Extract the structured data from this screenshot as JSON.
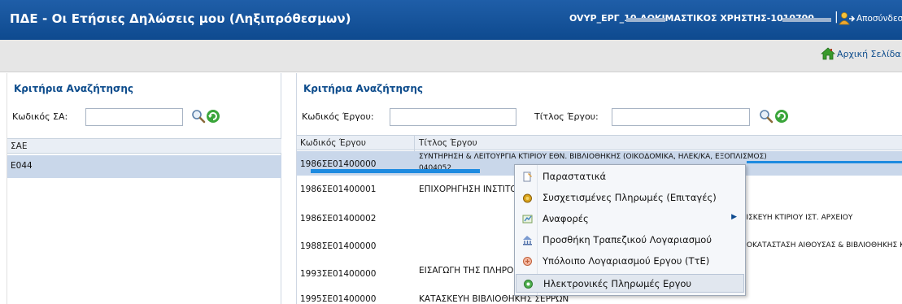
{
  "header": {
    "title": "ΠΔΕ - Οι Ετήσιες Δηλώσεις μου (Ληξιπρόθεσμων)",
    "user": "OVYP_ΕΡΓ_10-ΔΟΚΙΜΑΣΤΙΚΟΣ ΧΡΗΣΤΗΣ-1010700",
    "separator": "|",
    "logout_label": "Αποσύνδεση"
  },
  "subbar": {
    "home_label": "Αρχική Σελίδα"
  },
  "left_panel": {
    "title": "Κριτήρια Αναζήτησης",
    "code_label": "Κωδικός ΣΑ:",
    "code_value": "",
    "grid_header": "ΣΑΕ",
    "rows": [
      "E044"
    ]
  },
  "right_panel": {
    "title": "Κριτήρια Αναζήτησης",
    "project_code_label": "Κωδικός Έργου:",
    "project_code_value": "",
    "project_title_label": "Τίτλος Έργου:",
    "project_title_value": "",
    "columns": [
      "Κωδικός Έργου",
      "Τίτλος Έργου"
    ],
    "rows": [
      {
        "code": "1986ΣΕ01400000",
        "title": "ΣΥΝΤΗΡΗΣΗ & ΛΕΙΤΟΥΡΓΙΑ ΚΤΙΡΙΟΥ ΕΘΝ. ΒΙΒΛΙΟΘΗΚΗΣ (ΟΙΚΟΔΟΜΙΚΑ, ΗΛΕΚ/ΚΑ, ΕΞΟΠΛΙΣΜΟΣ)",
        "title2": "0404052"
      },
      {
        "code": "1986ΣΕ01400001",
        "title": "ΕΠΙΧΟΡΗΓΗΣΗ ΙΝΣΤΙΤΟΥΤΟΥ"
      },
      {
        "code": "1986ΣΕ01400002",
        "title": "ΕΠΙΣΚΕΥΗ ΚΤΙΡΙΟΥ ΙΣΤ. ΑΡΧΕΙΟΥ"
      },
      {
        "code": "1988ΣΕ01400000",
        "title": "ΑΠΟΚΑΤΑΣΤΑΣΗ ΑΙΘΟΥΣΑΣ & ΒΙΒΛΙΟΘΗΚΗΣ ΚΕΡΚΥΡΑΣ"
      },
      {
        "code": "1993ΣΕ01400000",
        "title": "ΕΙΣΑΓΩΓΗ ΤΗΣ ΠΛΗΡΟΦΟΡΙΚΗΣ ΣΤΑ ΑΡΧΕΙΑ ΕΛΛΑΔΟΣ (ΓΑΚ - ΕΡΓΟΥ"
      },
      {
        "code": "1995ΣΕ01400000",
        "title": "ΚΑΤΑΣΚΕΥΗ ΒΙΒΛΙΟΘΗΚΗΣ ΣΕΡΡΩΝ"
      }
    ]
  },
  "context_menu": {
    "items": [
      {
        "label": "Παραστατικά",
        "icon": "documents-icon"
      },
      {
        "label": "Συσχετισμένες Πληρωμές (Επιταγές)",
        "icon": "coins-icon"
      },
      {
        "label": "Αναφορές",
        "icon": "reports-icon",
        "submenu": true
      },
      {
        "label": "Προσθήκη Τραπεζικού Λογαριασμού",
        "icon": "bank-account-icon"
      },
      {
        "label": "Υπόλοιπο Λογαριασμού Εργου (ΤτΕ)",
        "icon": "balance-icon"
      },
      {
        "label": "Ηλεκτρονικές Πληρωμές Εργου",
        "icon": "e-payment-icon"
      }
    ]
  },
  "colors": {
    "header_bg": "#0e4a8f",
    "accent_title": "#0d4c8c",
    "selected_row": "#c9d7ea",
    "menu_bg": "#f5f7fa"
  }
}
